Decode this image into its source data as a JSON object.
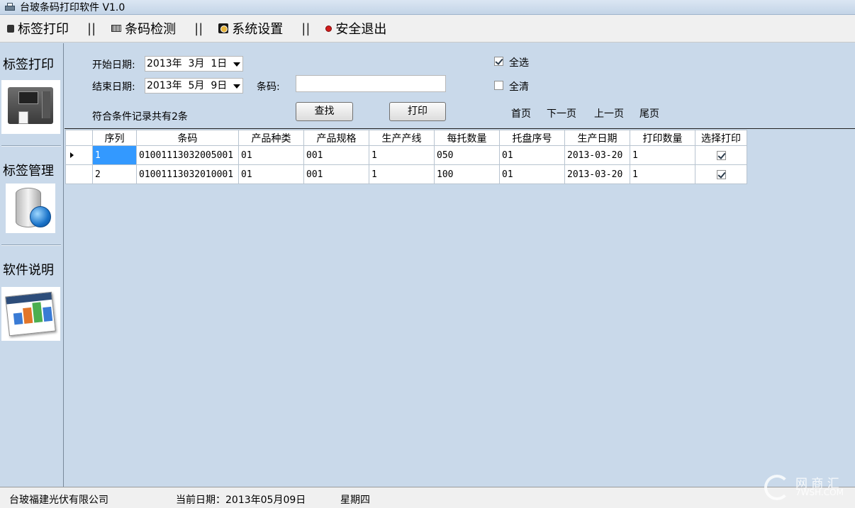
{
  "window": {
    "title": "台玻条码打印软件 V1.0"
  },
  "menu": {
    "items": [
      {
        "label": "标签打印",
        "icon": "printer-icon"
      },
      {
        "label": "条码检测",
        "icon": "barcode-icon"
      },
      {
        "label": "系统设置",
        "icon": "gear-icon"
      },
      {
        "label": "安全退出",
        "icon": "exit-icon"
      }
    ],
    "separator": "||"
  },
  "sidebar": {
    "items": [
      {
        "label": "标签打印",
        "icon": "label-printer-icon"
      },
      {
        "label": "标签管理",
        "icon": "database-icon"
      },
      {
        "label": "软件说明",
        "icon": "numbers-doc-icon"
      }
    ]
  },
  "filters": {
    "start_label": "开始日期:",
    "start_date": "2013年  3月  1日",
    "end_label": "结束日期:",
    "end_date": "2013年  5月  9日",
    "barcode_label": "条码:",
    "barcode_value": "",
    "select_all_label": "全选",
    "select_all_checked": true,
    "clear_all_label": "全清",
    "clear_all_checked": false,
    "search_button": "查找",
    "print_button": "打印",
    "result_summary": "符合条件记录共有2条"
  },
  "pager": {
    "first": "首页",
    "next": "下一页",
    "prev": "上一页",
    "last": "尾页"
  },
  "table": {
    "columns": [
      "序列",
      "条码",
      "产品种类",
      "产品规格",
      "生产产线",
      "每托数量",
      "托盘序号",
      "生产日期",
      "打印数量",
      "选择打印"
    ],
    "rows": [
      {
        "seq": "1",
        "barcode": "01001113032005001",
        "type": "01",
        "spec": "001",
        "line": "1",
        "qty_per_pallet": "050",
        "pallet_no": "01",
        "date": "2013-03-20",
        "print_qty": "1",
        "selected": true
      },
      {
        "seq": "2",
        "barcode": "01001113032010001",
        "type": "01",
        "spec": "001",
        "line": "1",
        "qty_per_pallet": "100",
        "pallet_no": "01",
        "date": "2013-03-20",
        "print_qty": "1",
        "selected": true
      }
    ]
  },
  "status": {
    "company": "台玻福建光伏有限公司",
    "current_date": "当前日期：2013年05月09日",
    "weekday": "星期四"
  },
  "watermark": {
    "text": "网 商 汇",
    "sub": "7WSH.COM"
  }
}
